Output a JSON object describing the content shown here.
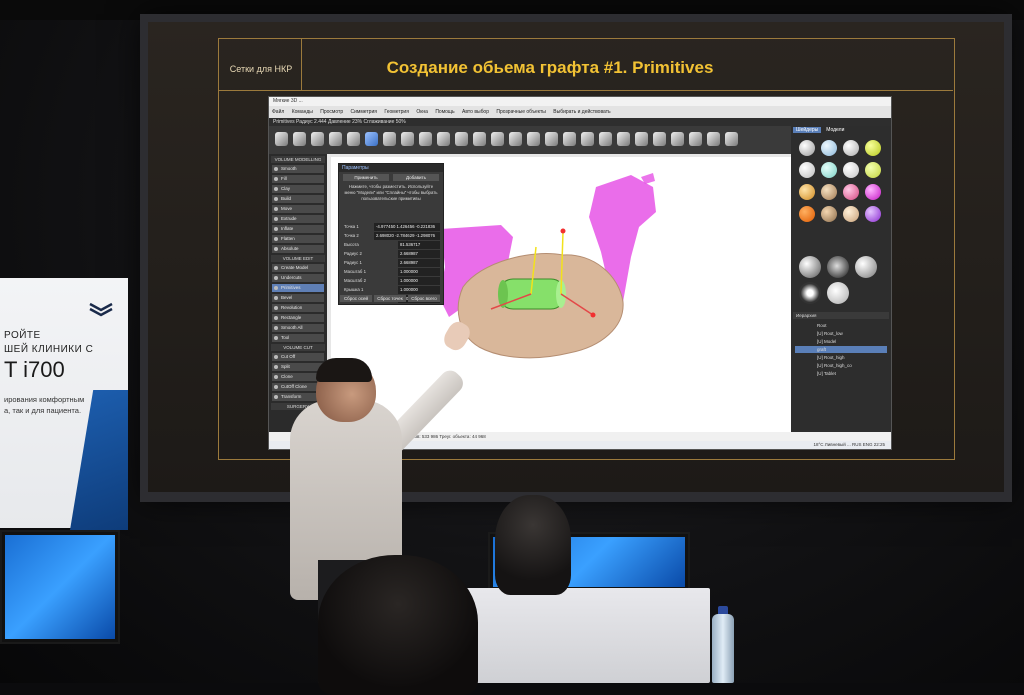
{
  "slide": {
    "tag": "Сетки для НКР",
    "title": "Создание обьема графта #1. Primitives"
  },
  "app": {
    "title": "Мягкие 3D ...",
    "menu": [
      "Файл",
      "Команды",
      "Просмотр",
      "Симметрия",
      "Геометрия",
      "Окна",
      "Помощь",
      "Авто выбор",
      "Прозрачные объекты",
      "Выбирать и действовать"
    ],
    "tool_bar": "Primitives   Радиус 2.444   Давление 23%   Сглаживание 50%",
    "sidebar": {
      "section1": "VOLUME MODELLING",
      "tools1": [
        "Smooth",
        "Fill",
        "Clay",
        "Build",
        "Move",
        "Extrude",
        "Inflate",
        "Flatten",
        "Absolute"
      ],
      "section2": "VOLUME EDIT",
      "tools2": [
        "Create Model",
        "Undercuts",
        "Primitives",
        "Bevel",
        "Revolution",
        "Rectangle",
        "Smooth All",
        "Tool"
      ],
      "section3": "VOLUME CUT",
      "tools3": [
        "Cut Off",
        "Split",
        "Clone",
        "CutOff Clone",
        "Transform"
      ],
      "section4": "SURGERY"
    },
    "params": {
      "title": "Параметры",
      "apply_label": "Применить",
      "add_label": "Добавить",
      "hint": "Нажмите, чтобы разместить. Используйте меню \"Модели\" или \"Сплайны\" чтобы выбрать пользовательские примитивы",
      "point1_label": "Точка 1",
      "point1_value": "-4.977450  1.426456  -0.221836",
      "point2_label": "Точка 2",
      "point2_value": "2.698020  -2.784629  -1.298076",
      "rows": [
        {
          "label": "Высота",
          "value": "81.536717"
        },
        {
          "label": "Радиус 2",
          "value": "2.668987"
        },
        {
          "label": "Радиус 1",
          "value": "2.668987"
        },
        {
          "label": "Масштаб 1",
          "value": "1.000000"
        },
        {
          "label": "Масштаб 2",
          "value": "1.000000"
        },
        {
          "label": "Крышка 1",
          "value": "1.000000"
        },
        {
          "label": "Крышка 2",
          "value": "1.000000"
        }
      ],
      "footer_buttons": [
        "Сброс осей",
        "Сброс точек",
        "Сброс всего"
      ]
    },
    "right_panel": {
      "tabs": [
        "Шейдеры",
        "Модели"
      ],
      "layers_title": "Иерархия",
      "layers": [
        "Root",
        "[U] Root_low",
        "[U] Model",
        "graft",
        "[U] Root_high",
        "[U] Root_high_co",
        "[U] Tablet"
      ]
    },
    "status": "Вершин: 1 146 (Graft) Видно треугольников: 533 986  Треуг. объекта: 44 968",
    "taskbar": "18°C Ливневый ...  RUS  ENG  22:25"
  },
  "banner": {
    "line1": "РОЙТЕ",
    "line2": "ШЕЙ КЛИНИКИ С",
    "model": "T i700",
    "line4": "ирования комфортным",
    "line5": "а, так и для пациента."
  },
  "colors": {
    "title_gold": "#f2c234",
    "frame_gold": "#9c7a3c",
    "graft_green": "#86e06a",
    "tissue_magenta": "#e653e6",
    "bone_tan": "#d9b79a"
  }
}
